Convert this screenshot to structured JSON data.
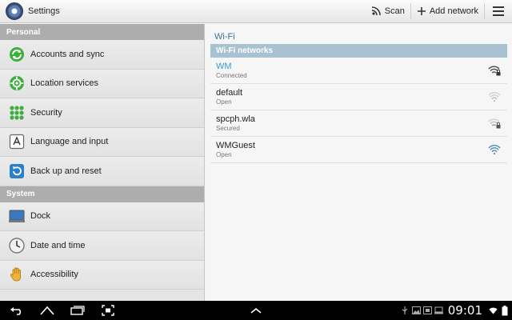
{
  "actionbar": {
    "title": "Settings",
    "scan_label": "Scan",
    "add_network_label": "Add network"
  },
  "left": {
    "personal_header": "Personal",
    "personal_items": [
      {
        "label": "Accounts and sync",
        "icon": "sync-icon"
      },
      {
        "label": "Location services",
        "icon": "location-icon"
      },
      {
        "label": "Security",
        "icon": "security-grid-icon"
      },
      {
        "label": "Language and input",
        "icon": "keyboard-a-icon"
      },
      {
        "label": "Back up and reset",
        "icon": "backup-icon"
      }
    ],
    "system_header": "System",
    "system_items": [
      {
        "label": "Dock",
        "icon": "dock-icon"
      },
      {
        "label": "Date and time",
        "icon": "clock-icon"
      },
      {
        "label": "Accessibility",
        "icon": "hand-icon"
      }
    ]
  },
  "right": {
    "title": "Wi-Fi",
    "networks_header": "Wi-Fi networks",
    "networks": [
      {
        "name": "WM",
        "status": "Connected",
        "secured": true,
        "active": true
      },
      {
        "name": "default",
        "status": "Open",
        "secured": false,
        "active": false
      },
      {
        "name": "spcph.wla",
        "status": "Secured",
        "secured": true,
        "active": false
      },
      {
        "name": "WMGuest",
        "status": "Open",
        "secured": false,
        "active": false
      }
    ]
  },
  "statusbar": {
    "clock": "09:01"
  },
  "colors": {
    "accent": "#3a9bd0",
    "section_header": "#adadad",
    "wifi_header": "#a9c2d2"
  }
}
